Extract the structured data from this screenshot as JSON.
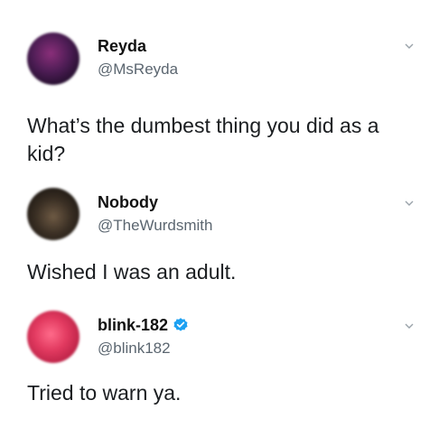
{
  "tweets": [
    {
      "name": "Reyda",
      "handle": "@MsReyda",
      "text": "What’s the dumbest thing you did as a kid?",
      "verified": false
    },
    {
      "name": "Nobody",
      "handle": "@TheWurdsmith",
      "text": "Wished I was an adult.",
      "verified": false
    },
    {
      "name": "blink-182",
      "handle": "@blink182",
      "text": "Tried to warn ya.",
      "verified": true
    }
  ],
  "colors": {
    "verified_badge": "#1da1f2",
    "handle_text": "#5b6670",
    "chevron": "#9aa3aa"
  },
  "icons": {
    "chevron": "chevron-down-icon",
    "verified": "verified-badge-icon"
  }
}
